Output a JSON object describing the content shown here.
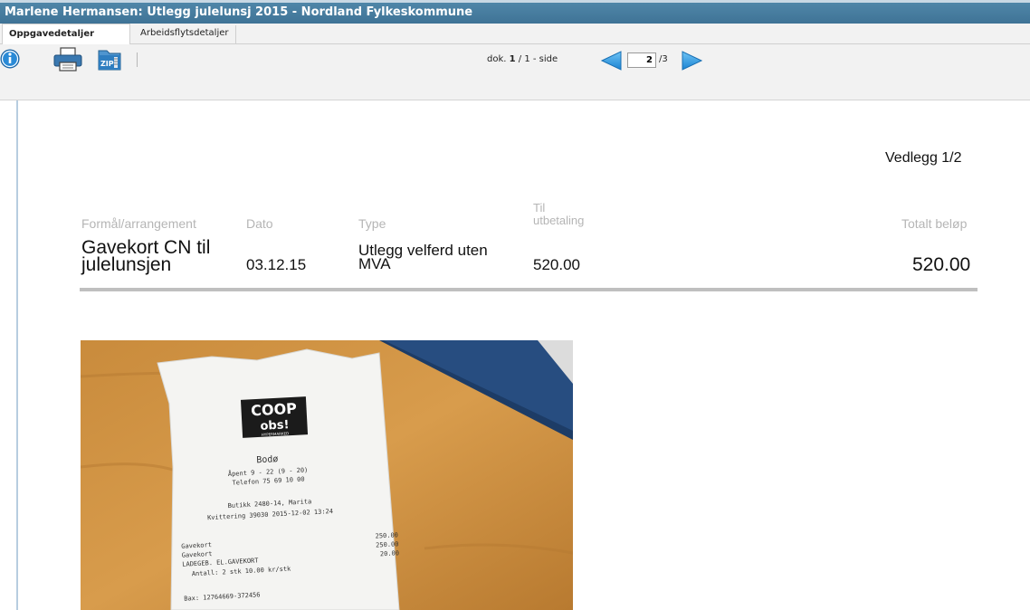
{
  "window": {
    "title": "Marlene Hermansen: Utlegg julelunsj 2015 - Nordland Fylkeskommune"
  },
  "tabs": [
    {
      "label": "Oppgavedetaljer",
      "active": true
    },
    {
      "label": "Arbeidsflytsdetaljer",
      "active": false
    }
  ],
  "toolbar": {
    "icons": [
      "info-icon",
      "printer-icon",
      "zip-icon"
    ],
    "zip_label": "ZIP",
    "dok_prefix": "dok. ",
    "dok_current": "1",
    "dok_suffix": " / 1 - side",
    "page_value": "2",
    "page_total": "/3",
    "colors": {
      "arrow": "#1e90d8",
      "title_bar": "#427899"
    }
  },
  "document": {
    "attachment_label": "Vedlegg 1/2",
    "headers": {
      "purpose": "Formål/arrangement",
      "date": "Dato",
      "type": "Type",
      "payout_line1": "Til",
      "payout_line2": "utbetaling",
      "total": "Totalt beløp"
    },
    "row": {
      "purpose_line1": "Gavekort CN til",
      "purpose_line2": "julelunsjen",
      "date": "03.12.15",
      "type_line1": "Utlegg velferd uten",
      "type_line2": "MVA",
      "payout": "520.00",
      "total": "520.00"
    }
  },
  "receipt": {
    "logo_line1": "COOP",
    "logo_line2": "obs!",
    "logo_sub": "HYPERMARKED",
    "city": "Bodø",
    "hours": "Åpent 9 - 22 (9 - 20)",
    "phone": "Telefon 75 69 10 00",
    "store": "Butikk 2480-14, Marita",
    "receipt_no": "Kvittering 39030 2015-12-02 13:24",
    "item1": "Gavekort",
    "item2": "Gavekort",
    "item3": "LADEGEB. EL.GAVEKORT",
    "qty": "Antall: 2 stk  10.00 kr/stk",
    "price1": "250.00",
    "price2": "250.00",
    "price3": "20.00",
    "bax": "Bax: 12764669-372456"
  }
}
